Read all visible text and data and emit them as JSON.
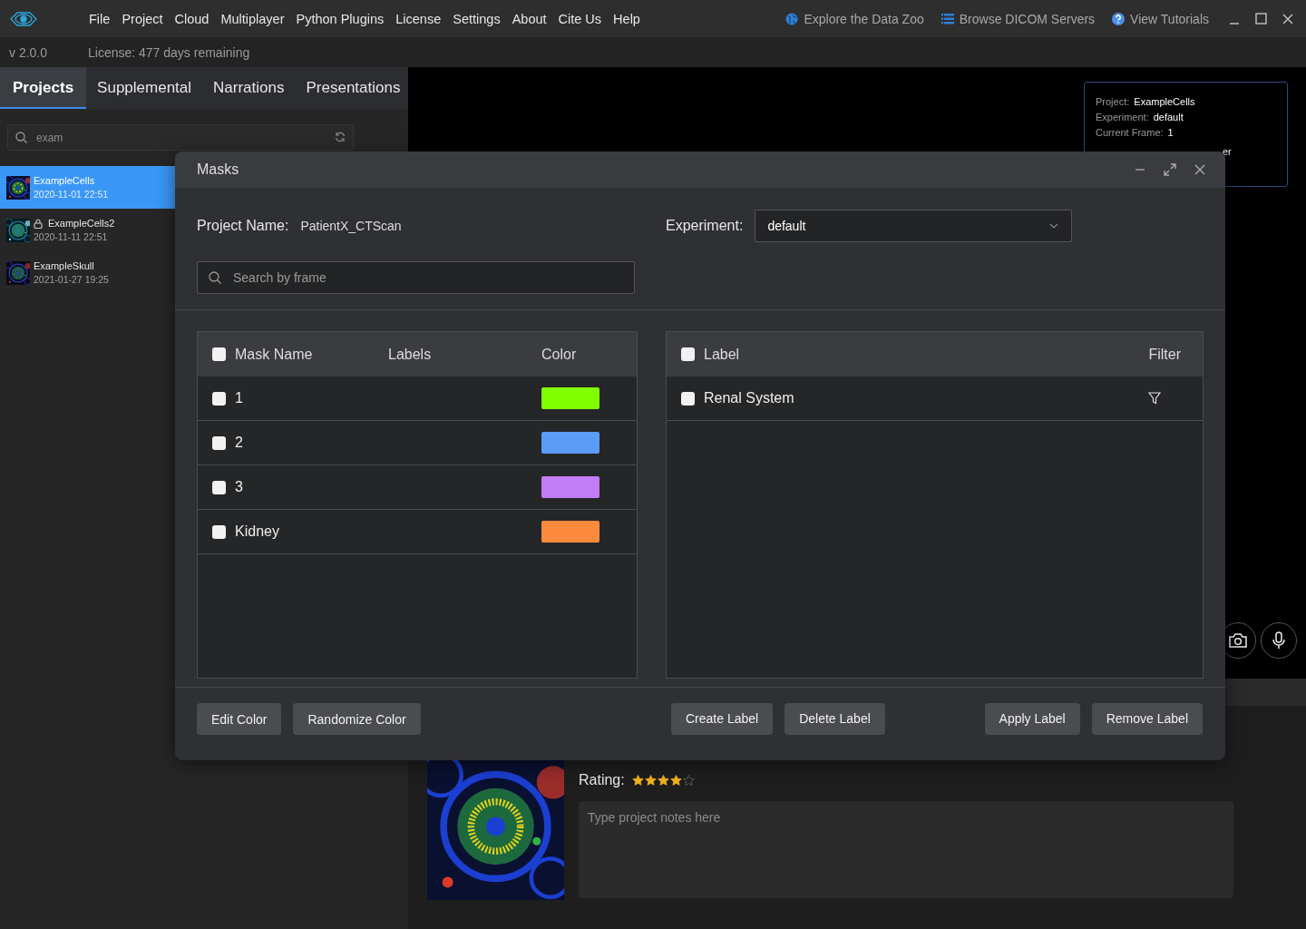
{
  "menubar": {
    "items": [
      "File",
      "Project",
      "Cloud",
      "Multiplayer",
      "Python Plugins",
      "License",
      "Settings",
      "About",
      "Cite Us",
      "Help"
    ],
    "links": [
      {
        "label": "Explore the Data Zoo",
        "kind": "globe"
      },
      {
        "label": "Browse DICOM Servers",
        "kind": "list"
      },
      {
        "label": "View Tutorials",
        "kind": "help"
      }
    ]
  },
  "status": {
    "version": "v 2.0.0",
    "license": "License: 477 days remaining"
  },
  "sidebar": {
    "tabs": [
      {
        "label": "Projects",
        "selected": true
      },
      {
        "label": "Supplemental",
        "selected": false
      },
      {
        "label": "Narrations",
        "selected": false
      },
      {
        "label": "Presentations",
        "selected": false
      }
    ],
    "search": {
      "value": "exam"
    },
    "projects": [
      {
        "name": "ExampleCells",
        "date": "2020-11-01 22:51",
        "locked": false,
        "selected": true
      },
      {
        "name": "ExampleCells2",
        "date": "2020-11-11 22:51",
        "locked": true,
        "selected": false
      },
      {
        "name": "ExampleSkull",
        "date": "2021-01-27 19:25",
        "locked": false,
        "selected": false
      }
    ]
  },
  "viewer": {
    "info": [
      {
        "label": "Project:",
        "value": "ExampleCells"
      },
      {
        "label": "Experiment:",
        "value": "default"
      },
      {
        "label": "Current Frame:",
        "value": "1"
      }
    ],
    "info_fragment": "er"
  },
  "details": {
    "rating_label": "Rating:",
    "stars": 4,
    "notes": {
      "placeholder": "Type project notes here"
    }
  },
  "modal": {
    "title": "Masks",
    "project_name_label": "Project Name:",
    "project_name": "PatientX_CTScan",
    "experiment_label": "Experiment:",
    "experiment": "default",
    "search": {
      "placeholder": "Search by frame"
    },
    "mask_table": {
      "checked": false,
      "columns": [
        "Mask Name",
        "Labels",
        "Color"
      ],
      "rows": [
        {
          "name": "1",
          "color": "#80ff00",
          "checked": false
        },
        {
          "name": "2",
          "color": "#5b9cf6",
          "checked": false
        },
        {
          "name": "3",
          "color": "#c27cf6",
          "checked": false
        },
        {
          "name": "Kidney",
          "color": "#fb8a3c",
          "checked": false
        }
      ]
    },
    "label_table": {
      "checked": false,
      "columns": [
        "Label",
        "Filter"
      ],
      "rows": [
        {
          "name": "Renal System",
          "checked": false
        }
      ]
    },
    "button_groups": [
      [
        "Edit Color",
        "Randomize Color"
      ],
      [
        "Create Label",
        "Delete Label"
      ],
      [
        "Apply Label",
        "Remove Label"
      ]
    ]
  }
}
